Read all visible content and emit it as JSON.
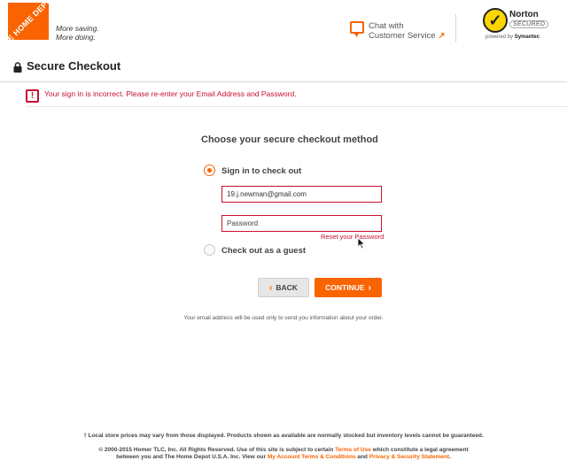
{
  "header": {
    "logo_text": "THE HOME DEPOT",
    "tagline_line1": "More saving.",
    "tagline_line2": "More doing.",
    "chat_line1": "Chat with",
    "chat_line2": "Customer Service",
    "norton_name": "Norton",
    "norton_secured": "SECURED",
    "norton_powered_prefix": "powered by",
    "norton_powered_brand": "Symantec"
  },
  "page": {
    "title": "Secure Checkout",
    "error_message": "Your sign in is incorrect. Please re-enter your Email Address and Password."
  },
  "form": {
    "method_title": "Choose your secure checkout method",
    "option_signin": "Sign in to check out",
    "email_value": "19.j.newman@gmail.com",
    "password_placeholder": "Password",
    "reset_link": "Reset your Password",
    "option_guest": "Check out as a guest",
    "back_label": "BACK",
    "continue_label": "CONTINUE",
    "email_note": "Your email address will be used only to send you information about your order."
  },
  "footer": {
    "disclaimer": "† Local store prices may vary from those displayed. Products shown as available are normally stocked but inventory levels cannot be guaranteed.",
    "legal_a": "© 2000-2015 Homer TLC, Inc. All Rights Reserved. Use of this site is subject to certain",
    "legal_terms_link": "Terms of Use",
    "legal_b": "which constitute a legal agreement",
    "legal_c": "between you and The Home Depot U.S.A. Inc. View our",
    "legal_account_link": "My Account Terms & Conditions",
    "legal_and": "and",
    "legal_privacy_link": "Privacy & Security Statement",
    "legal_end": "."
  },
  "colors": {
    "brand": "#f96302",
    "error": "#c8102e"
  }
}
